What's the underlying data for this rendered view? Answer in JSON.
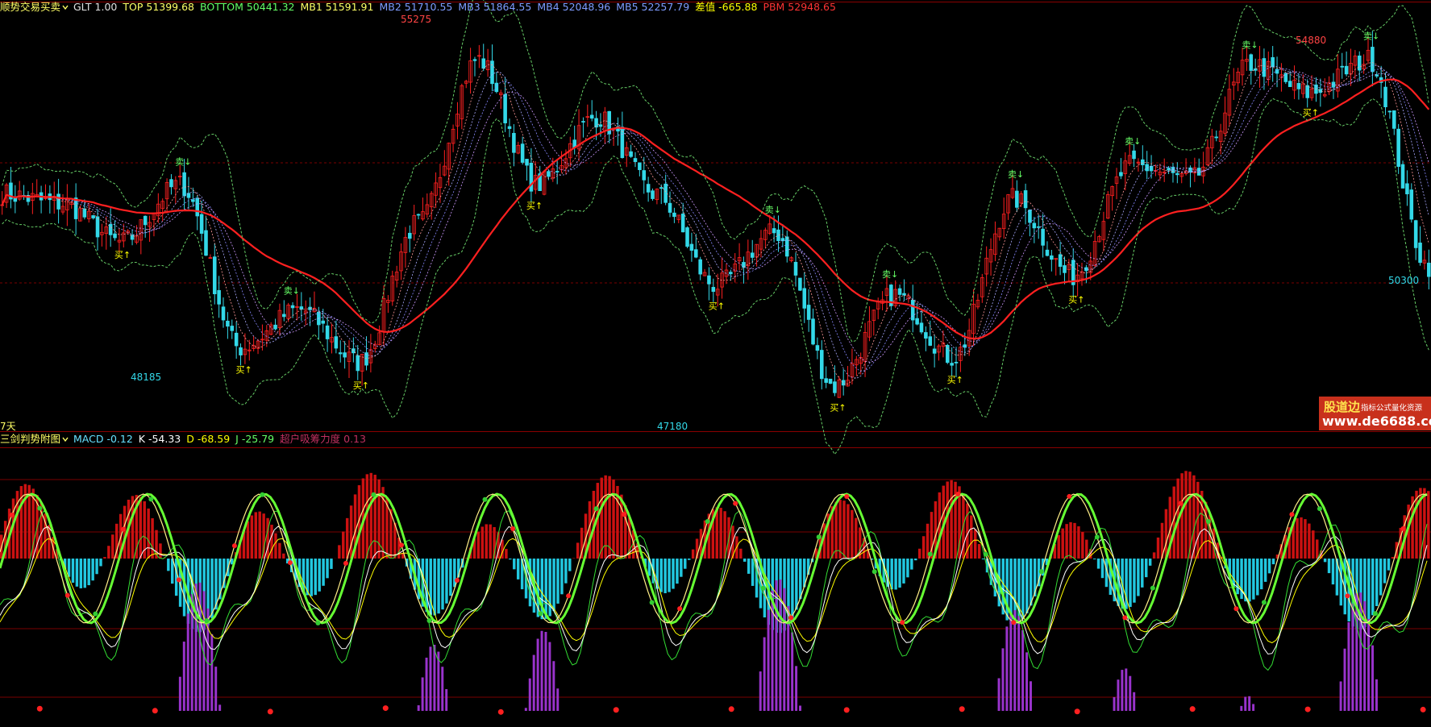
{
  "main_panel": {
    "indicator_name": "顺势交易买卖",
    "readouts": [
      {
        "label": "GLT",
        "value": "1.00",
        "color": "#e0e0e0"
      },
      {
        "label": "TOP",
        "value": "51399.68",
        "color": "#ffff66"
      },
      {
        "label": "BOTTOM",
        "value": "50441.32",
        "color": "#66ff66"
      },
      {
        "label": "MB1",
        "value": "51591.91",
        "color": "#ffff66"
      },
      {
        "label": "MB2",
        "value": "51710.55",
        "color": "#7f9cff"
      },
      {
        "label": "MB3",
        "value": "51864.55",
        "color": "#7f9cff"
      },
      {
        "label": "MB4",
        "value": "52048.96",
        "color": "#7f9cff"
      },
      {
        "label": "MB5",
        "value": "52257.79",
        "color": "#7f9cff"
      },
      {
        "label": "差值",
        "value": "-665.88",
        "color": "#ffff00"
      },
      {
        "label": "PBM",
        "value": "52948.65",
        "color": "#ff3333"
      }
    ],
    "corner_label": "7天"
  },
  "sub_panel": {
    "indicator_name": "三剑判势附图",
    "readouts": [
      {
        "label": "MACD",
        "value": "-0.12",
        "color": "#66e0ff"
      },
      {
        "label": "K",
        "value": "-54.33",
        "color": "#ffffff"
      },
      {
        "label": "D",
        "value": "-68.59",
        "color": "#ffff00"
      },
      {
        "label": "J",
        "value": "-25.79",
        "color": "#66ff66"
      },
      {
        "label": "超户吸筹力度",
        "value": "0.13",
        "color": "#c03060"
      }
    ]
  },
  "watermark": {
    "line1": "股道边",
    "line1_sub": "指标公式量化资源",
    "line2": "www.de6688.com"
  },
  "colors": {
    "up": "#ff2020",
    "down": "#33d8e8",
    "ma_red": "#ff2020",
    "band_green": "#66cc66",
    "macd_pos": "#cc1111",
    "macd_neg": "#22c8e0",
    "purple": "#9933cc",
    "grid_red": "#7a0000",
    "signal_buy": "#ffff00",
    "signal_sell": "#66ff66"
  },
  "chart_data": [
    {
      "type": "candlestick",
      "panel": "main",
      "price_labels": [
        {
          "text": "55275",
          "color": "#ff4444"
        },
        {
          "text": "48185",
          "color": "#33d8e8"
        },
        {
          "text": "47180",
          "color": "#33d8e8"
        },
        {
          "text": "54880",
          "color": "#ff4444"
        },
        {
          "text": "50300",
          "color": "#33d8e8"
        }
      ],
      "ohlc_anchor_closes": [
        51800,
        51600,
        50800,
        52000,
        48600,
        49400,
        48300,
        51200,
        54600,
        52000,
        53400,
        51800,
        49900,
        51000,
        47800,
        49700,
        48400,
        51700,
        50100,
        52400,
        52100,
        54500,
        53900,
        54600,
        50300
      ],
      "buy_label": "买",
      "sell_label": "卖"
    },
    {
      "type": "indicator",
      "panel": "sub",
      "series": [
        "MACD histogram",
        "K",
        "D",
        "J",
        "超户吸筹力度"
      ]
    }
  ]
}
